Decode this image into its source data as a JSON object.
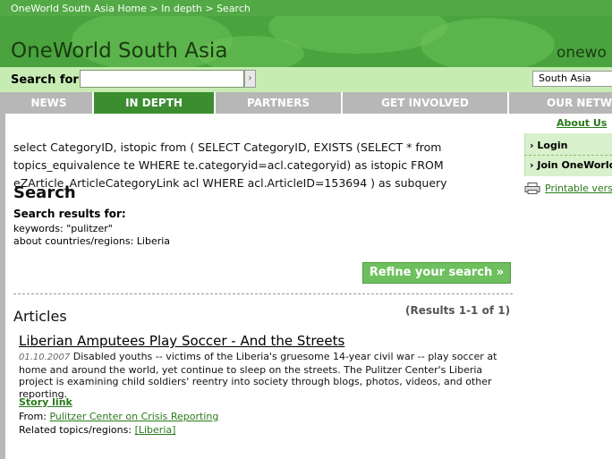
{
  "header": {
    "breadcrumb": "OneWorld South Asia Home > In depth > Search",
    "site_title": "OneWorld South Asia",
    "brand_right": "onewo",
    "search_label": "Search for",
    "search_value": "",
    "region_selected": "South Asia"
  },
  "nav": {
    "tabs": [
      {
        "label": "NEWS"
      },
      {
        "label": "IN DEPTH",
        "active": true
      },
      {
        "label": "PARTNERS"
      },
      {
        "label": "GET INVOLVED"
      },
      {
        "label": "OUR NETW"
      }
    ]
  },
  "sidebar": {
    "about_us": "About Us",
    "login": "Login",
    "join": "Join OneWorld",
    "printable": "Printable versi"
  },
  "main": {
    "sql_text": "select CategoryID, istopic from ( SELECT CategoryID, EXISTS (SELECT * from topics_equivalence te WHERE te.categoryid=acl.categoryid) as istopic FROM eZArticle_ArticleCategoryLink acl WHERE acl.ArticleID=153694 ) as subquery",
    "heading": "Search",
    "results_for": "Search results for:",
    "keywords": "keywords: \"pulitzer\"",
    "countries": "about countries/regions: Liberia",
    "refine_button": "Refine your search »",
    "articles_heading": "Articles",
    "results_count": "(Results 1-1 of 1)",
    "article": {
      "title": "Liberian Amputees Play Soccer - And the Streets",
      "date": "01.10.2007",
      "summary": "Disabled youths -- victims of the Liberia's gruesome 14-year civil war -- play soccer at home and around the world, yet continue to sleep on the streets. The Pulitzer Center's Liberia project is examining child soldiers' reentry into society through blogs, photos, videos, and other reporting.",
      "story_link": "Story link",
      "from_label": "From:",
      "from_value": "Pulitzer Center on Crisis Reporting",
      "related_label": "Related topics/regions:",
      "related_value": "[Liberia]"
    }
  },
  "colors": {
    "header_green": "#4aa33e",
    "search_bar": "#c7ecb3",
    "nav_gray": "#b7b7b7",
    "active_tab": "#3b8d2f",
    "link_green": "#2a7a1a",
    "refine_button": "#6ec05e"
  },
  "icons": {
    "printer": "printer-icon",
    "go_arrow": "arrow-right-icon"
  }
}
